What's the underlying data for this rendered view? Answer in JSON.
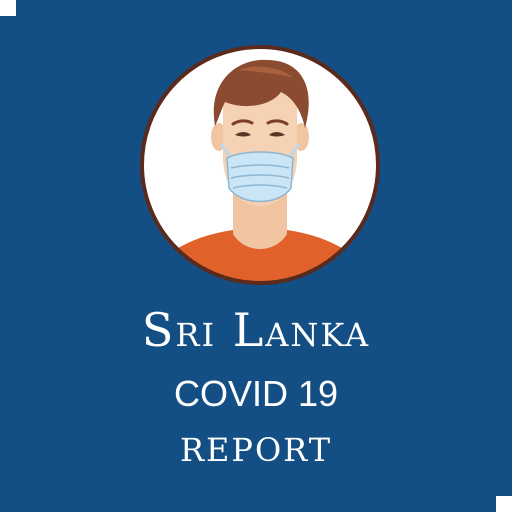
{
  "title": {
    "country": "Sri Lanka",
    "disease": "COVID 19",
    "document": "REPORT"
  },
  "avatar": {
    "icon": "masked-man-icon"
  },
  "colors": {
    "background": "#134f85",
    "text": "#ffffff",
    "avatar_ring": "#5a2a1c",
    "avatar_fill": "#ffffff",
    "hair": "#8b4b30",
    "skin": "#f6d2b4",
    "shirt": "#e0622a",
    "mask": "#c9e5f6"
  }
}
